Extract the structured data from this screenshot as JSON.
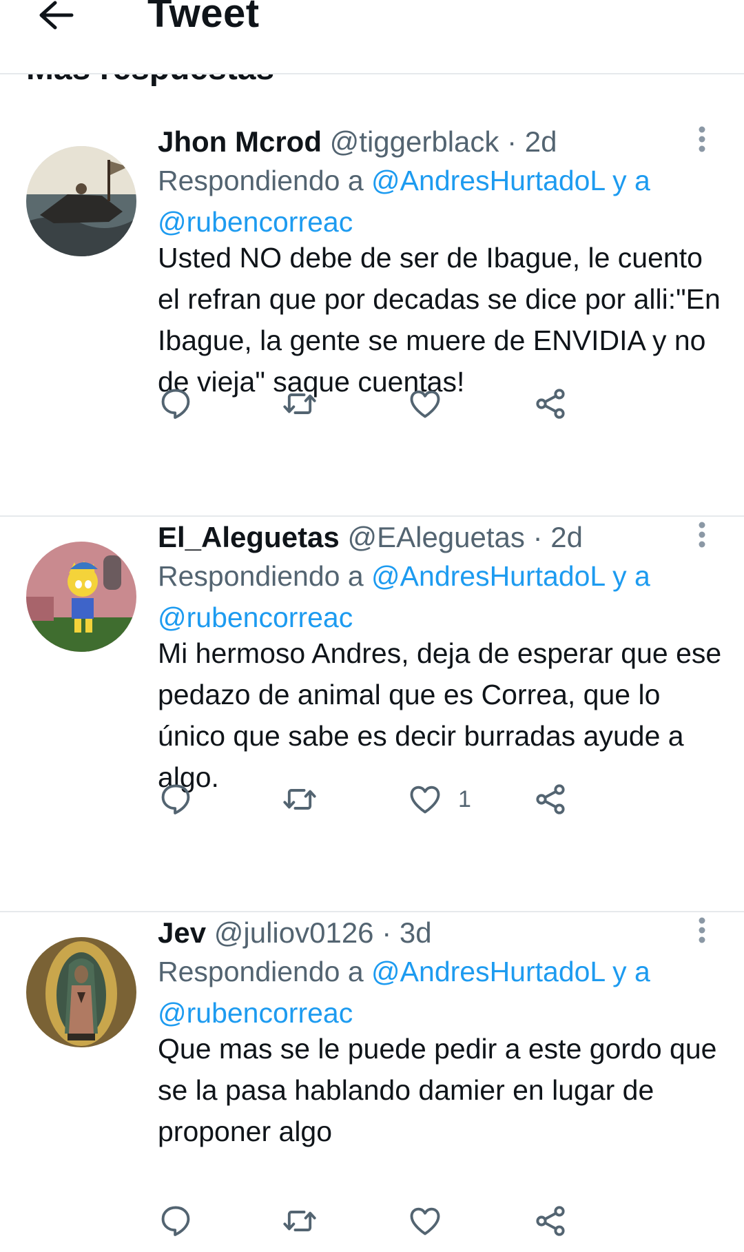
{
  "header": {
    "title": "Tweet",
    "back_icon": "arrow-left-icon"
  },
  "section": {
    "heading": "Más respuestas"
  },
  "colors": {
    "link": "#1d9bf0",
    "secondary_text": "#536471",
    "primary_text": "#0f1419",
    "divider": "#e6e9ec"
  },
  "tweets": [
    {
      "name": "Jhon Mcrod",
      "handle": "@tiggerblack",
      "dot": "·",
      "time": "2d",
      "replying_prefix": "Respondiendo a",
      "mention1": "@AndresHurtadoL",
      "joiner": "y a",
      "mention2": "@rubencorreac",
      "text": "Usted NO debe de ser de Ibague, le cuento el refran que por decadas se dice por alli:\"En Ibague, la gente se muere de ENVIDIA y no de vieja\" saque cuentas!",
      "likes": ""
    },
    {
      "name": "El_Aleguetas",
      "handle": "@EAleguetas",
      "dot": "·",
      "time": "2d",
      "replying_prefix": "Respondiendo a",
      "mention1": "@AndresHurtadoL",
      "joiner": "y a",
      "mention2": "@rubencorreac",
      "text": "Mi hermoso Andres, deja de esperar que ese pedazo de animal que es Correa, que lo único que sabe es decir burradas ayude a algo.",
      "likes": "1"
    },
    {
      "name": "Jev",
      "handle": "@juliov0126",
      "dot": "·",
      "time": "3d",
      "replying_prefix": "Respondiendo a",
      "mention1": "@AndresHurtadoL",
      "joiner": "y a",
      "mention2": "@rubencorreac",
      "text": "Que mas se le puede pedir a este gordo que se la pasa hablando damier en lugar de proponer algo",
      "likes": ""
    }
  ]
}
